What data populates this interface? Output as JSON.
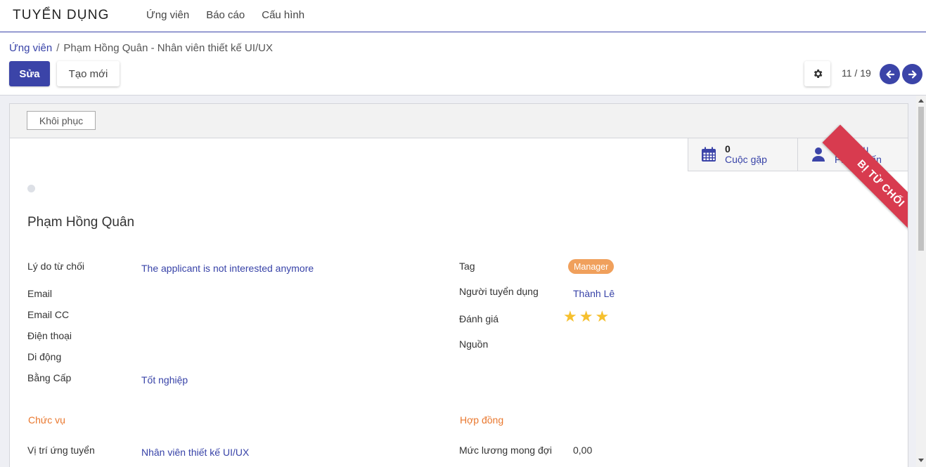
{
  "navbar": {
    "brand": "TUYỂN DỤNG",
    "menu": [
      "Ứng viên",
      "Báo cáo",
      "Cấu hình"
    ]
  },
  "breadcrumb": {
    "parent": "Ứng viên",
    "separator": "/",
    "current": "Phạm Hồng Quân - Nhân viên thiết kế UI/UX"
  },
  "toolbar": {
    "edit_label": "Sửa",
    "create_label": "Tạo mới",
    "settings_icon": "gear-icon",
    "pager": "11 / 19",
    "prev_icon": "arrow-left-icon",
    "next_icon": "arrow-right-icon"
  },
  "statusbar": {
    "restore_label": "Khôi phục"
  },
  "smart_buttons": {
    "meetings": {
      "count": "0",
      "label": "Cuộc gặp",
      "icon": "calendar-icon"
    },
    "interview": {
      "line1": "Bắt đầu",
      "line2": "Phóng vấn",
      "icon": "user-icon"
    }
  },
  "ribbon": {
    "text": "BỊ TỪ CHỐI",
    "color": "#d83b4f"
  },
  "applicant": {
    "name": "Phạm Hồng Quân",
    "left_fields": {
      "refuse_reason_label": "Lý do từ chối",
      "refuse_reason_value": "The applicant is not interested anymore",
      "email_label": "Email",
      "email_cc_label": "Email CC",
      "phone_label": "Điện thoại",
      "mobile_label": "Di động",
      "degree_label": "Bằng Cấp",
      "degree_value": "Tốt nghiệp"
    },
    "right_fields": {
      "tag_label": "Tag",
      "tag_value": "Manager",
      "recruiter_label": "Người tuyển dụng",
      "recruiter_value": "Thành Lê",
      "rating_label": "Đánh giá",
      "rating_stars": 3,
      "source_label": "Nguồn"
    },
    "sections": {
      "job_title": "Chức vụ",
      "contract": "Hợp đồng"
    },
    "job_fields": {
      "applied_job_label": "Vị trí ứng tuyển",
      "applied_job_value": "Nhân viên thiết kế UI/UX"
    },
    "contract_fields": {
      "expected_salary_label": "Mức lương mong đợi",
      "expected_salary_value": "0,00"
    }
  },
  "colors": {
    "primary": "#3b44a8",
    "section": "#e9772d",
    "tag": "#f0a05c",
    "star": "#f6c02e"
  }
}
